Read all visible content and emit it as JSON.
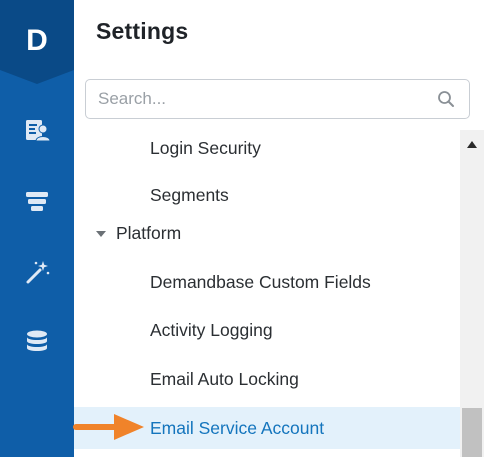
{
  "rail": {
    "logo": "D",
    "icons": [
      "id-card-icon",
      "funnel-icon",
      "magic-wand-icon",
      "database-icon"
    ]
  },
  "header": {
    "title": "Settings"
  },
  "search": {
    "placeholder": "Search...",
    "value": ""
  },
  "tree": {
    "items": [
      {
        "label": "Login Security",
        "type": "child"
      },
      {
        "label": "Segments",
        "type": "child"
      },
      {
        "label": "Platform",
        "type": "group",
        "expanded": true
      },
      {
        "label": "Demandbase Custom Fields",
        "type": "child"
      },
      {
        "label": "Activity Logging",
        "type": "child"
      },
      {
        "label": "Email Auto Locking",
        "type": "child"
      },
      {
        "label": "Email Service Account",
        "type": "child",
        "selected": true
      }
    ]
  },
  "colors": {
    "rail": "#0f5ea8",
    "selected_bg": "#e3f1fb",
    "selected_text": "#1475bd",
    "annotation_arrow": "#f0832a"
  }
}
